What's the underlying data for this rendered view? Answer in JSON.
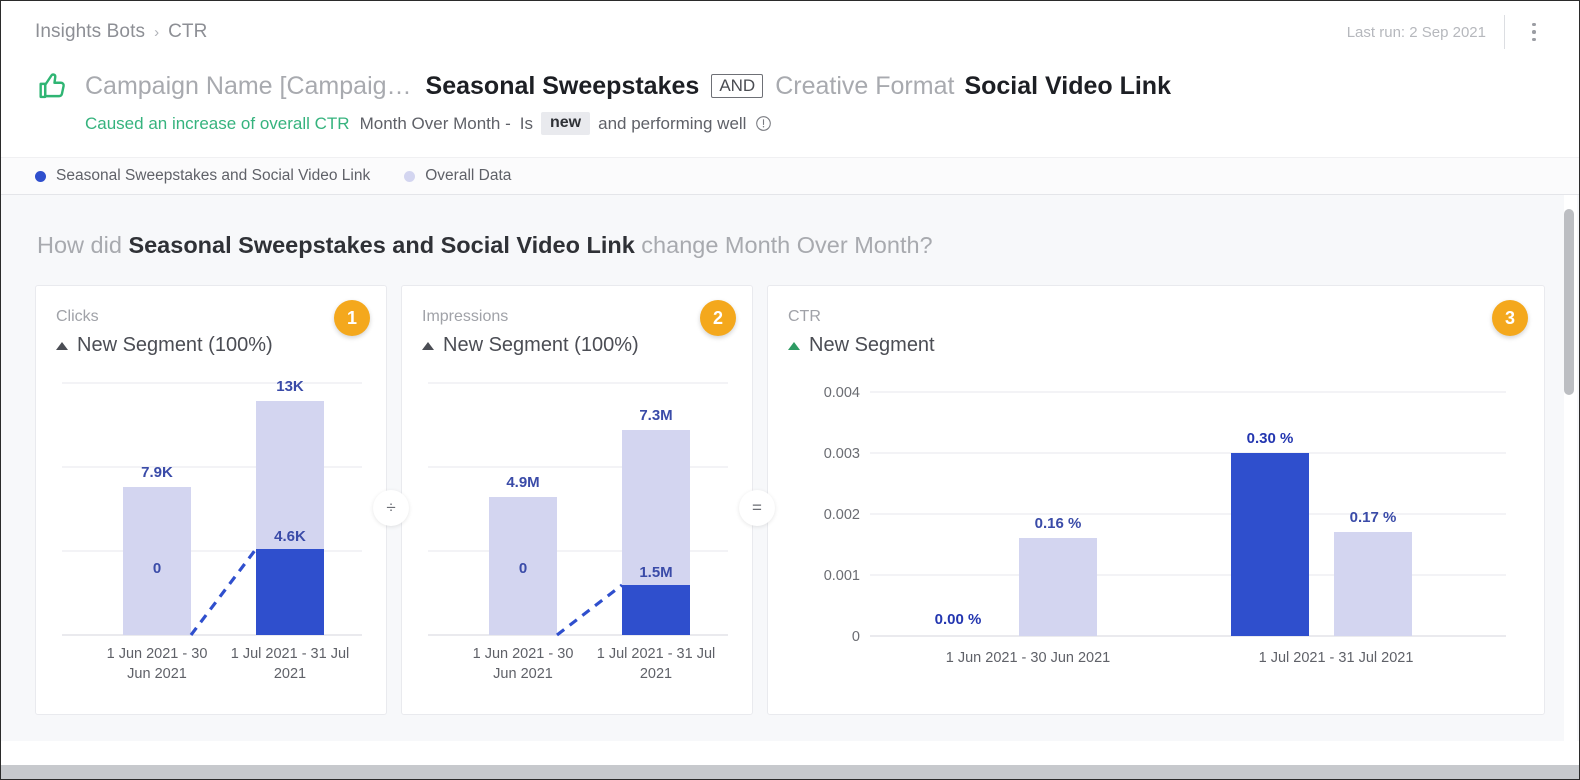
{
  "header": {
    "breadcrumb": {
      "root": "Insights Bots",
      "separator": "›",
      "current": "CTR"
    },
    "last_run": "Last run: 2 Sep 2021",
    "kebab_label": "more-options",
    "title": {
      "dimension1_label": "Campaign Name [Campaig…",
      "dimension1_value": "Seasonal Sweepstakes",
      "operator": "AND",
      "dimension2_label": "Creative Format",
      "dimension2_value": "Social Video Link"
    },
    "subtitle": {
      "effect": "Caused an increase of overall CTR",
      "period": "Month Over Month -",
      "is": "Is",
      "badge": "new",
      "tail": "and performing well"
    }
  },
  "legend": {
    "items": [
      {
        "label": "Seasonal Sweepstakes and Social Video Link",
        "color": "#2F4FCD"
      },
      {
        "label": "Overall Data",
        "color": "#D3D5F0"
      }
    ]
  },
  "question": {
    "prefix": "How did ",
    "subject": "Seasonal Sweepstakes and Social Video Link",
    "suffix": " change Month Over Month?"
  },
  "operators": {
    "divide": "÷",
    "equals": "="
  },
  "colors": {
    "segment_blue": "#2F4FCD",
    "overall_lavender": "#D3D5F0",
    "badge_orange": "#F4A81D",
    "green": "#36B37E",
    "label_blue": "#3A4BA8"
  },
  "cards": [
    {
      "badge": "1",
      "metric": "Clicks",
      "segment": "New Segment (100%)",
      "triangle_color": "#4B4D54"
    },
    {
      "badge": "2",
      "metric": "Impressions",
      "segment": "New Segment (100%)",
      "triangle_color": "#4B4D54"
    },
    {
      "badge": "3",
      "metric": "CTR",
      "segment": "New Segment",
      "triangle_color": "#2E9B63"
    }
  ],
  "chart_data": [
    {
      "type": "bar",
      "title": "Clicks",
      "stacked": true,
      "categories": [
        "1 Jun 2021 - 30 Jun 2021",
        "1 Jul 2021 - 31 Jul 2021"
      ],
      "category_labels_wrapped": [
        [
          "1 Jun 2021 - 30",
          "Jun 2021"
        ],
        [
          "1 Jul 2021 - 31 Jul",
          "2021"
        ]
      ],
      "series": [
        {
          "name": "Seasonal Sweepstakes and Social Video Link",
          "color": "#2F4FCD",
          "values": [
            0,
            4600
          ],
          "labels": [
            "0",
            "4.6K"
          ]
        },
        {
          "name": "Overall Data",
          "color": "#D3D5F0",
          "values": [
            7900,
            13000
          ],
          "labels": [
            "7.9K",
            "13K"
          ]
        }
      ],
      "total_labels": [
        "7.9K",
        "13K"
      ],
      "trend_line": {
        "style": "dashed",
        "color": "#2F4FCD",
        "values": [
          0,
          4600
        ]
      },
      "ylim": [
        0,
        16000
      ],
      "grid": true,
      "ylabel": "",
      "xlabel": ""
    },
    {
      "type": "bar",
      "title": "Impressions",
      "stacked": true,
      "categories": [
        "1 Jun 2021 - 30 Jun 2021",
        "1 Jul 2021 - 31 Jul 2021"
      ],
      "category_labels_wrapped": [
        [
          "1 Jun 2021 - 30",
          "Jun 2021"
        ],
        [
          "1 Jul 2021 - 31 Jul",
          "2021"
        ]
      ],
      "series": [
        {
          "name": "Seasonal Sweepstakes and Social Video Link",
          "color": "#2F4FCD",
          "values": [
            0,
            1500000
          ],
          "labels": [
            "0",
            "1.5M"
          ]
        },
        {
          "name": "Overall Data",
          "color": "#D3D5F0",
          "values": [
            4900000,
            7300000
          ],
          "labels": [
            "4.9M",
            "7.3M"
          ]
        }
      ],
      "total_labels": [
        "4.9M",
        "7.3M"
      ],
      "trend_line": {
        "style": "dashed",
        "color": "#2F4FCD",
        "values": [
          0,
          1500000
        ]
      },
      "ylim": [
        0,
        9700000
      ],
      "grid": true,
      "ylabel": "",
      "xlabel": ""
    },
    {
      "type": "bar",
      "title": "CTR",
      "stacked": false,
      "categories": [
        "1 Jun 2021 - 30 Jun 2021",
        "1 Jul 2021 - 31 Jul 2021"
      ],
      "yticks": [
        "0.004",
        "0.003",
        "0.002",
        "0.001",
        "0"
      ],
      "ytick_values": [
        0.004,
        0.003,
        0.002,
        0.001,
        0
      ],
      "series": [
        {
          "name": "Seasonal Sweepstakes and Social Video Link",
          "color": "#2F4FCD",
          "values": [
            0.0,
            0.003
          ],
          "labels": [
            "0.00 %",
            "0.30 %"
          ]
        },
        {
          "name": "Overall Data",
          "color": "#D3D5F0",
          "values": [
            0.0016,
            0.0017
          ],
          "labels": [
            "0.16 %",
            "0.17 %"
          ]
        }
      ],
      "ylim": [
        0,
        0.0044
      ],
      "grid": true,
      "ylabel": "",
      "xlabel": ""
    }
  ]
}
